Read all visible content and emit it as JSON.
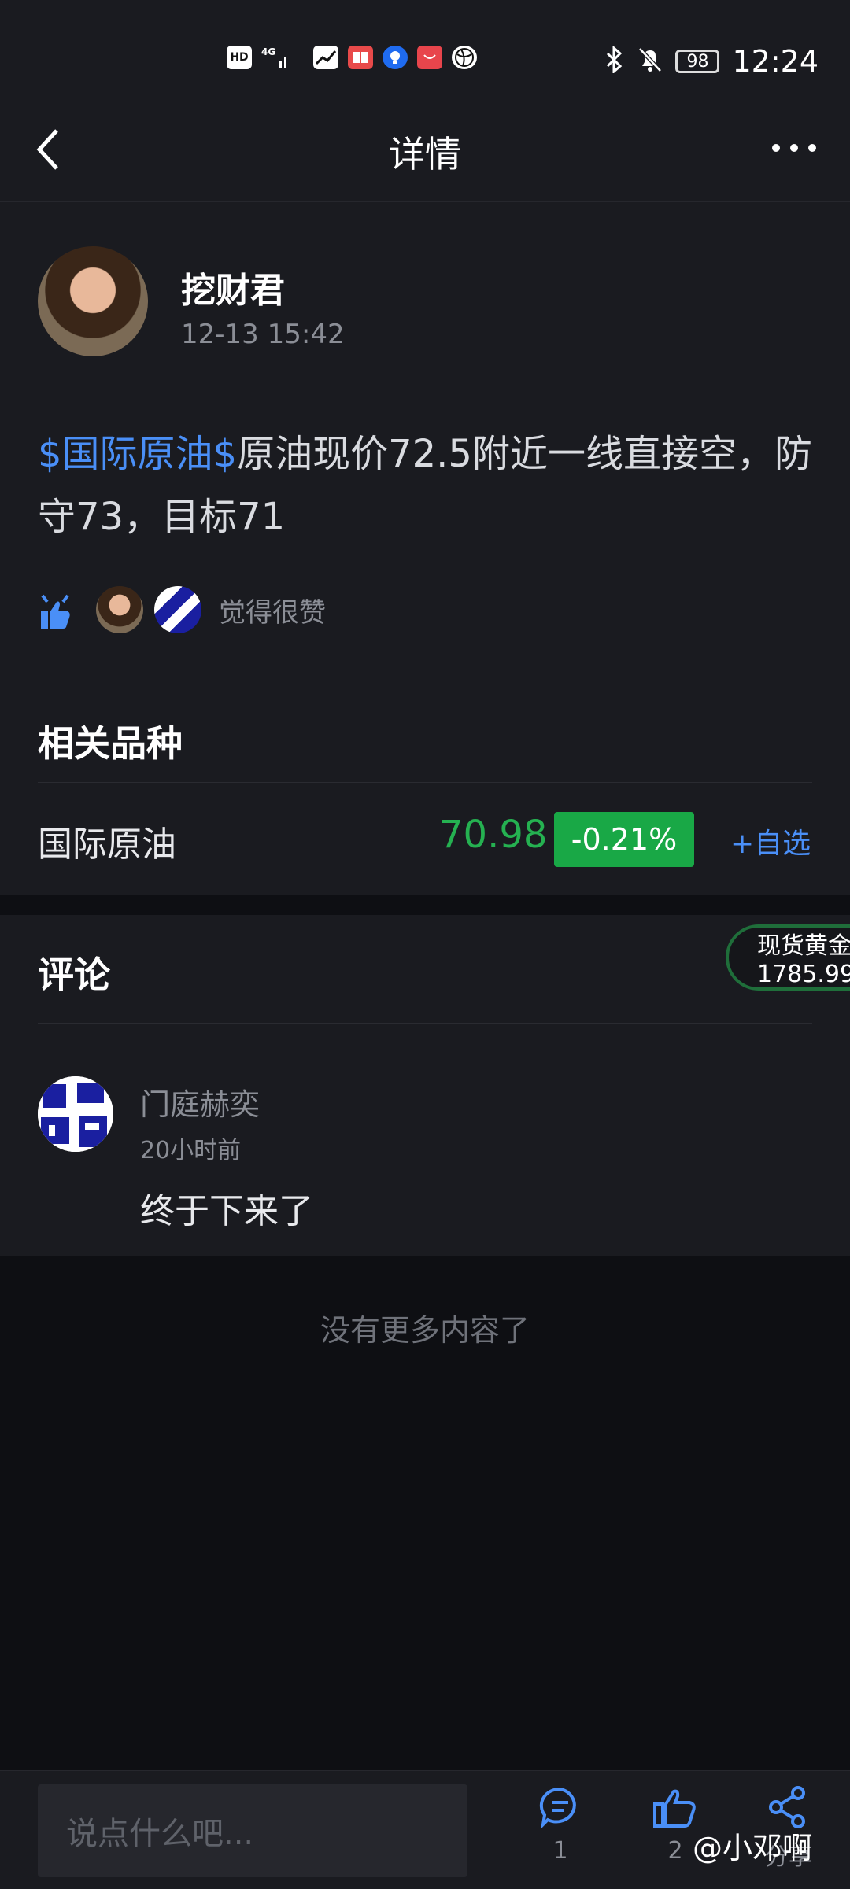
{
  "status_bar": {
    "time": "12:24",
    "battery": "98",
    "left_icons": [
      "hd-icon",
      "signal-4g-icon",
      "stock-app-icon",
      "book-app-icon",
      "bulb-app-icon",
      "huawei-app-icon",
      "ball-app-icon"
    ],
    "right_icons": [
      "bluetooth-icon",
      "bell-off-icon"
    ]
  },
  "header": {
    "title": "详情"
  },
  "post": {
    "author": "挖财君",
    "time": "12-13 15:42",
    "tag": "$国际原油$",
    "text": "原油现价72.5附近一线直接空，防守73，目标71",
    "likes_label": "觉得很赞"
  },
  "related": {
    "title": "相关品种",
    "name": "国际原油",
    "price": "70.98",
    "change": "-0.21%",
    "add_label": "+自选"
  },
  "floating_quote": {
    "name": "现货黄金",
    "price": "1785.99"
  },
  "comments": {
    "title": "评论",
    "items": [
      {
        "user": "门庭赫奕",
        "time": "20小时前",
        "text": "终于下来了"
      }
    ]
  },
  "no_more": "没有更多内容了",
  "bottom_bar": {
    "input_placeholder": "说点什么吧...",
    "comment_count": "1",
    "like_count": "2",
    "share_label": "分享"
  },
  "watermark": "@小邓啊",
  "colors": {
    "accent_blue": "#4a8ff7",
    "up_green": "#19a846",
    "bg_card": "#1a1b20",
    "bg_page": "#0e0f13"
  }
}
